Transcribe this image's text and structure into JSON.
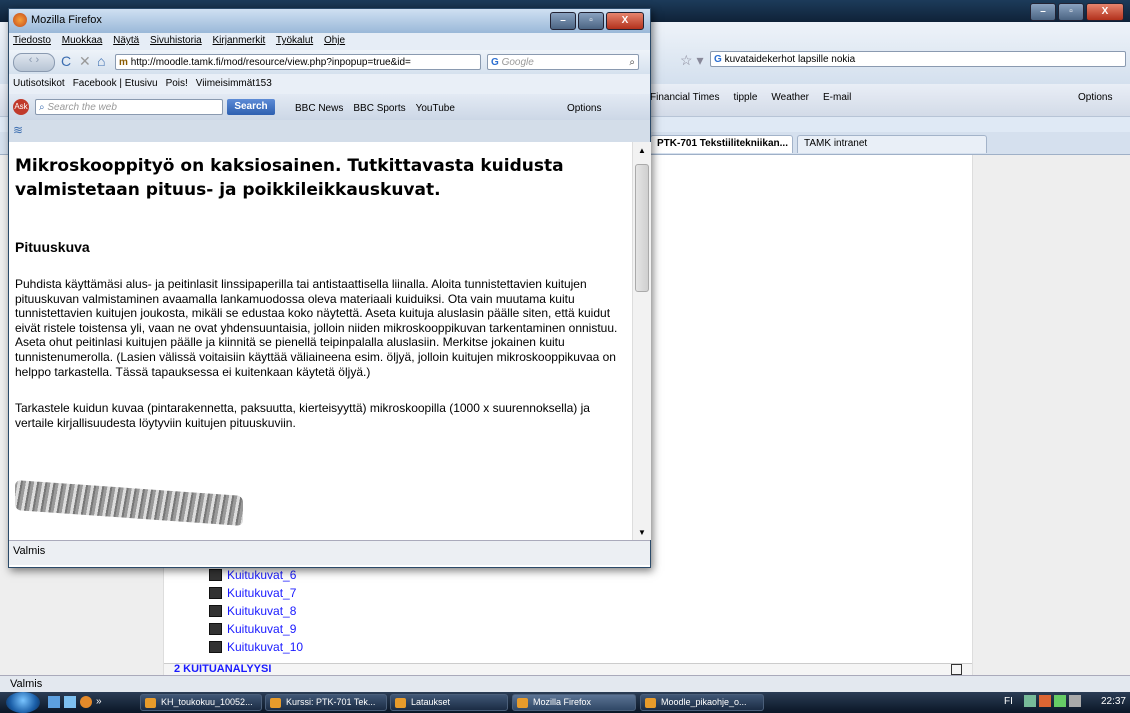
{
  "background_window": {
    "search_text": "kuvataidekerhot lapsille nokia",
    "toolbar_items": [
      "Financial Times",
      "tipple",
      "Weather",
      "E-mail"
    ],
    "options_label": "Options",
    "tabs": [
      "PTK-701 Tekstiilitekniikan...",
      "TAMK intranet"
    ],
    "links": [
      "Kuitukuvat_6",
      "Kuitukuvat_7",
      "Kuitukuvat_8",
      "Kuitukuvat_9",
      "Kuitukuvat_10"
    ],
    "section_heading": "2   KUITUANALYYSI",
    "status": "Valmis"
  },
  "popup": {
    "title": "Mozilla Firefox",
    "menu": [
      "Tiedosto",
      "Muokkaa",
      "Näytä",
      "Sivuhistoria",
      "Kirjanmerkit",
      "Työkalut",
      "Ohje"
    ],
    "url": "http://moodle.tamk.fi/mod/resource/view.php?inpopup=true&id=",
    "search_placeholder": "Google",
    "bookmarks": [
      "Uutisotsikot",
      "Facebook | Etusivu",
      "Pois!",
      "Viimeisimmät153"
    ],
    "ask_placeholder": "Search the web",
    "ask_button": "Search",
    "ask_links": [
      "BBC News",
      "BBC Sports",
      "YouTube"
    ],
    "options_label": "Options",
    "heading": "Mikroskooppityö on kaksiosainen. Tutkittavasta kuidusta valmistetaan pituus- ja poikkileikkauskuvat.",
    "subheading": "Pituuskuva",
    "paragraph1": "Puhdista käyttämäsi alus- ja peitinlasit linssipaperilla tai antistaattisella liinalla. Aloita tunnistettavien kuitujen pituuskuvan valmistaminen avaamalla lankamuodossa oleva materiaali kuiduiksi. Ota vain muutama kuitu tunnistettavien kuitujen joukosta, mikäli se edustaa koko näytettä. Aseta kuituja aluslasin päälle siten, että kuidut eivät ristele toistensa yli, vaan ne ovat yhdensuuntaisia, jolloin niiden mikroskooppikuvan tarkentaminen onnistuu. Aseta ohut peitinlasi kuitujen päälle ja kiinnitä se pienellä teipinpalalla aluslasiin. Merkitse jokainen kuitu tunnistenumerolla. (Lasien välissä voitaisiin käyttää väliaineena esim. öljyä, jolloin kuitujen mikroskooppikuvaa on helppo tarkastella. Tässä tapauksessa ei kuitenkaan käytetä öljyä.)",
    "paragraph2": "Tarkastele kuidun kuvaa (pintarakennetta, paksuutta, kierteisyyttä) mikroskoopilla (1000 x suurennoksella) ja vertaile kirjallisuudesta löytyviin kuitujen pituuskuviin.",
    "status": "Valmis"
  },
  "taskbar": {
    "buttons": [
      "KH_toukokuu_10052...",
      "Kurssi: PTK-701 Tek...",
      "Lataukset",
      "Mozilla Firefox",
      "Moodle_pikaohje_o..."
    ],
    "locale": "FI",
    "clock": "22:37"
  },
  "colors": {
    "link": "#1a1aff",
    "accent": "#2c6fd1"
  }
}
